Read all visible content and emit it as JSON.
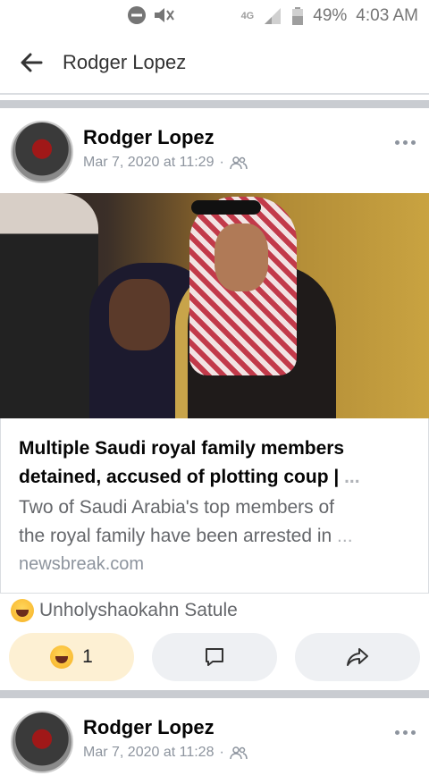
{
  "status_bar": {
    "network": "4G",
    "battery": "49%",
    "time": "4:03 AM"
  },
  "top_bar": {
    "title": "Rodger Lopez"
  },
  "posts": [
    {
      "author": "Rodger Lopez",
      "date": "Mar 7, 2020 at 11:29",
      "link": {
        "title_line1": "Multiple Saudi royal family members",
        "title_line2": "detained, accused of plotting coup |",
        "desc_line1": "Two of Saudi Arabia's top members of",
        "desc_line2": "the royal family have been arrested in",
        "ellipsis": "...",
        "domain": "newsbreak.com"
      },
      "reaction_by": "Unholyshaokahn Satule",
      "reaction_count": "1"
    },
    {
      "author": "Rodger Lopez",
      "date": "Mar 7, 2020 at 11:28"
    }
  ]
}
